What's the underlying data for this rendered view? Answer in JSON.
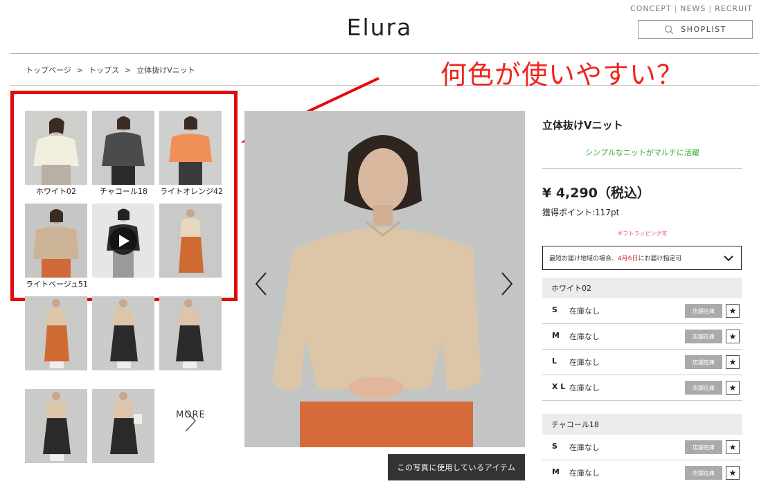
{
  "header": {
    "links": [
      "CONCEPT",
      "NEWS",
      "RECRUIT"
    ],
    "logo": "Elura",
    "shoplist_label": "SHOPLIST"
  },
  "breadcrumb": [
    "トップページ",
    "トップス",
    "立体抜けVニット"
  ],
  "annotation": "何色が使いやすい？",
  "thumbnails": {
    "color_labels": [
      "ホワイト02",
      "チャコール18",
      "ライトオレンジ42",
      "ライトベージュ51"
    ],
    "more_label": "MORE"
  },
  "main_image": {
    "items_button": "この写真に使用しているアイテム"
  },
  "product": {
    "title": "立体抜けVニット",
    "catchcopy": "シンプルなニットがマルチに活躍",
    "price": "¥ 4,290（税込）",
    "points": "獲得ポイント:117pt",
    "gift": "ギフトラッピング可",
    "delivery_prefix": "最短お届け地域の場合、",
    "delivery_date": "4月6日",
    "delivery_suffix": "にお届け指定可",
    "store_stock_label": "店舗在庫",
    "colors": [
      {
        "name": "ホワイト02",
        "sizes": [
          {
            "size": "S",
            "stock": "在庫なし"
          },
          {
            "size": "M",
            "stock": "在庫なし"
          },
          {
            "size": "L",
            "stock": "在庫なし"
          },
          {
            "size": "X L",
            "stock": "在庫なし"
          }
        ]
      },
      {
        "name": "チャコール18",
        "sizes": [
          {
            "size": "S",
            "stock": "在庫なし"
          },
          {
            "size": "M",
            "stock": "在庫なし"
          }
        ]
      }
    ]
  },
  "colors": {
    "annotation_red": "#e10a0a",
    "catch_green": "#3aaa35",
    "gift_pink": "#e4508f"
  }
}
